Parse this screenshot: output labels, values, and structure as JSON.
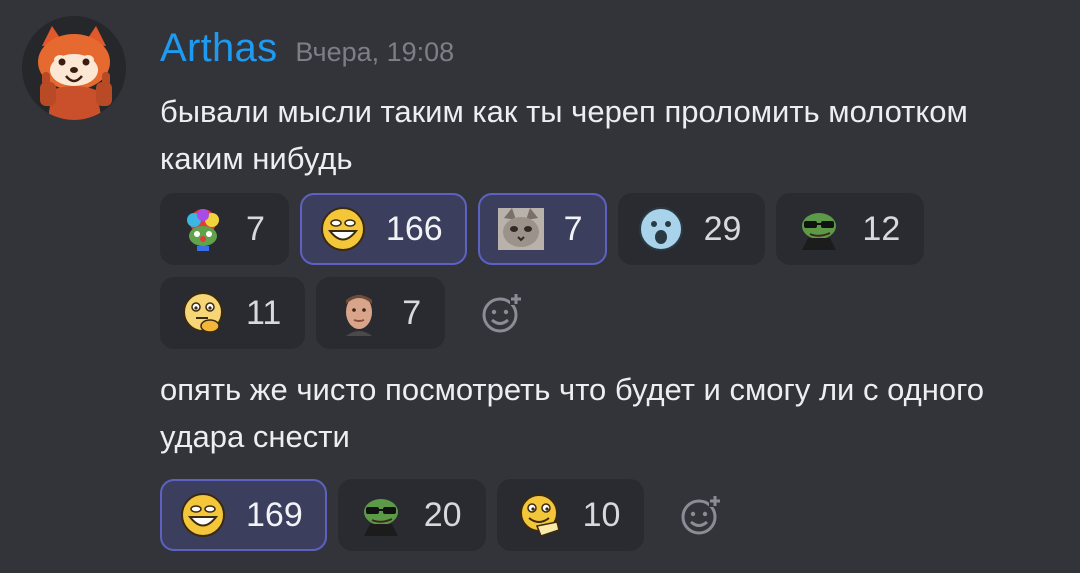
{
  "message": {
    "author": "Arthas",
    "timestamp": "Вчера, 19:08",
    "avatar_icon": "red-panda-thumbs-up",
    "paragraphs": [
      {
        "text": "бывали мысли таким как ты череп проломить молотком каким нибудь",
        "reactions": [
          {
            "emoji": "rainbow-clown-pepe",
            "count": "7",
            "active": false
          },
          {
            "emoji": "grinning-yellow-face",
            "count": "166",
            "active": true
          },
          {
            "emoji": "kitten-photo",
            "count": "7",
            "active": true
          },
          {
            "emoji": "surprised-blue-face",
            "count": "29",
            "active": false
          },
          {
            "emoji": "pepe-sunglasses",
            "count": "12",
            "active": false
          },
          {
            "emoji": "thinking-yellow-face",
            "count": "11",
            "active": false
          },
          {
            "emoji": "man-face-photo",
            "count": "7",
            "active": false
          }
        ]
      },
      {
        "text": "опять же чисто посмотреть что будет и смогу ли с одного удара снести",
        "reactions": [
          {
            "emoji": "grinning-yellow-face",
            "count": "169",
            "active": true
          },
          {
            "emoji": "pepe-sunglasses",
            "count": "20",
            "active": false
          },
          {
            "emoji": "thinking-pointing-face",
            "count": "10",
            "active": false
          }
        ]
      }
    ]
  },
  "colors": {
    "background": "#333439",
    "author": "#1e9bf0",
    "active_border": "#5d62c2",
    "active_fill": "#3b3e5c",
    "pill_fill": "#2a2b30"
  }
}
